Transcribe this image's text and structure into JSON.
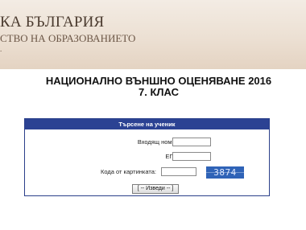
{
  "banner": {
    "line1": "КА БЪЛГАРИЯ",
    "line2": "СТВО НА ОБРАЗОВАНИЕТО",
    "line3": "."
  },
  "headline": {
    "title": "НАЦИОНАЛНО ВЪНШНО ОЦЕНЯВАНЕ 2016",
    "subtitle": "7. КЛАС"
  },
  "form": {
    "title": "Търсене на ученик",
    "entry_number_label": "Входящ номер:",
    "entry_number_value": "",
    "egn_label": "ЕГН :",
    "egn_value": "",
    "captcha_label": "Кода от картинката:",
    "captcha_value": "",
    "captcha_text": "3874",
    "submit_label": "[ -- Изведи -- ]"
  },
  "colors": {
    "panel_header": "#2b4293",
    "captcha_bg": "#2f63b7",
    "banner_bg": "#ece0d3"
  }
}
